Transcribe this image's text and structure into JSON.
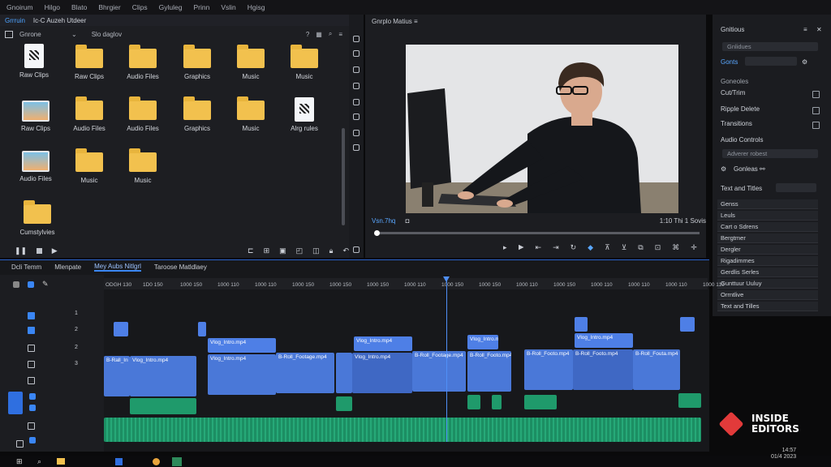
{
  "menu": [
    "Gnoirum",
    "Hilgo",
    "Blato",
    "Bhrgier",
    "Clips",
    "Gyluleg",
    "Prinn",
    "Vslin",
    "Hgisg"
  ],
  "project": {
    "tabs": [
      "Grrruin",
      "Ic-C Auzeh Utdeer"
    ],
    "toolbar_left": "Gnrone",
    "toolbar_mid": "Slo daglov",
    "items": [
      {
        "type": "file",
        "label": "Raw Clips"
      },
      {
        "type": "folder",
        "label": "Raw Clips"
      },
      {
        "type": "folder",
        "label": "Audio Files"
      },
      {
        "type": "folder",
        "label": "Graphics"
      },
      {
        "type": "folder",
        "label": "Music"
      },
      {
        "type": "folder",
        "label": "Music"
      },
      {
        "type": "image",
        "label": "Raw Clips"
      },
      {
        "type": "folder",
        "label": "Audio Files"
      },
      {
        "type": "folder",
        "label": "Audio Files"
      },
      {
        "type": "folder",
        "label": "Graphics"
      },
      {
        "type": "folder",
        "label": "Music"
      },
      {
        "type": "file",
        "label": "Alrg rules"
      },
      {
        "type": "image",
        "label": "Audio Files"
      },
      {
        "type": "folder",
        "label": "Music"
      },
      {
        "type": "folder",
        "label": "Music"
      },
      {
        "type": "folder",
        "label": "Cumstylvies"
      }
    ]
  },
  "monitor": {
    "title": "Gnrplo Matius",
    "timecode_left": "Vsn.7hq",
    "timecode_right": "1:10 Thi 1 Sovis"
  },
  "effects": {
    "header": "Gnitious",
    "dropdown1": "Gnlidues",
    "search_label": "Gonts",
    "section1": "Goneoles",
    "cut_trim": "Cut/Trim",
    "ripple_delete": "Ripple Delete",
    "transitions": "Transitions",
    "audio_controls": "Audio Controls",
    "audio_dropdown": "Adverer robest",
    "gonleas": "Gonleas",
    "text_titles": "Text and Titles",
    "list": [
      "Genss",
      "Leuls",
      "Cart o Sdrens",
      "Bergtmer",
      "Dergler",
      "Rigadimmes",
      "Gerdlis Serles",
      "Gunttuur Uuluy",
      "Orrntlive",
      "Text and Tilles"
    ]
  },
  "timeline": {
    "tabs": [
      "Dcli Temm",
      "Mlenpate",
      "Mey Aubs Nitlgrl",
      "Taroose Matldlaey"
    ],
    "ticks": [
      "ODGH 130",
      "1D0 150",
      "1000 150",
      "1000 110",
      "1000 110",
      "1000 150",
      "1000 150",
      "1000 150",
      "1000 110",
      "1000 150",
      "1000 150",
      "1000 110",
      "1000 150",
      "1000 110",
      "1000 110",
      "1000 110",
      "1000 110"
    ],
    "track_nums": [
      "1",
      "2",
      "2",
      "3"
    ],
    "clips_v3": [
      "Vlog_Intro.mp4",
      "Vlog_Intro.mp4",
      "Vlog_Intro.mp4",
      "Vlog_Intro.mp4"
    ],
    "clips_v2": [
      "Vlog_Intro.mp4",
      "B-Roll_Footage.mp4",
      "B-Roll_Footo.mp4",
      "B-Roll_Footo.mp4",
      "B-Roll_Footo.mp4",
      "B-Roll_Fouta.mp4"
    ],
    "clips_v1": [
      "B-Rall_In",
      "Vlog_Intro.mp4",
      "Vlog_Intro.mp4",
      "B-Roll_Footage.mp4"
    ]
  },
  "brand": {
    "line1": "INSIDE",
    "line2": "EDITORS"
  },
  "clock": {
    "time": "14:57",
    "date": "01/4 2023"
  }
}
